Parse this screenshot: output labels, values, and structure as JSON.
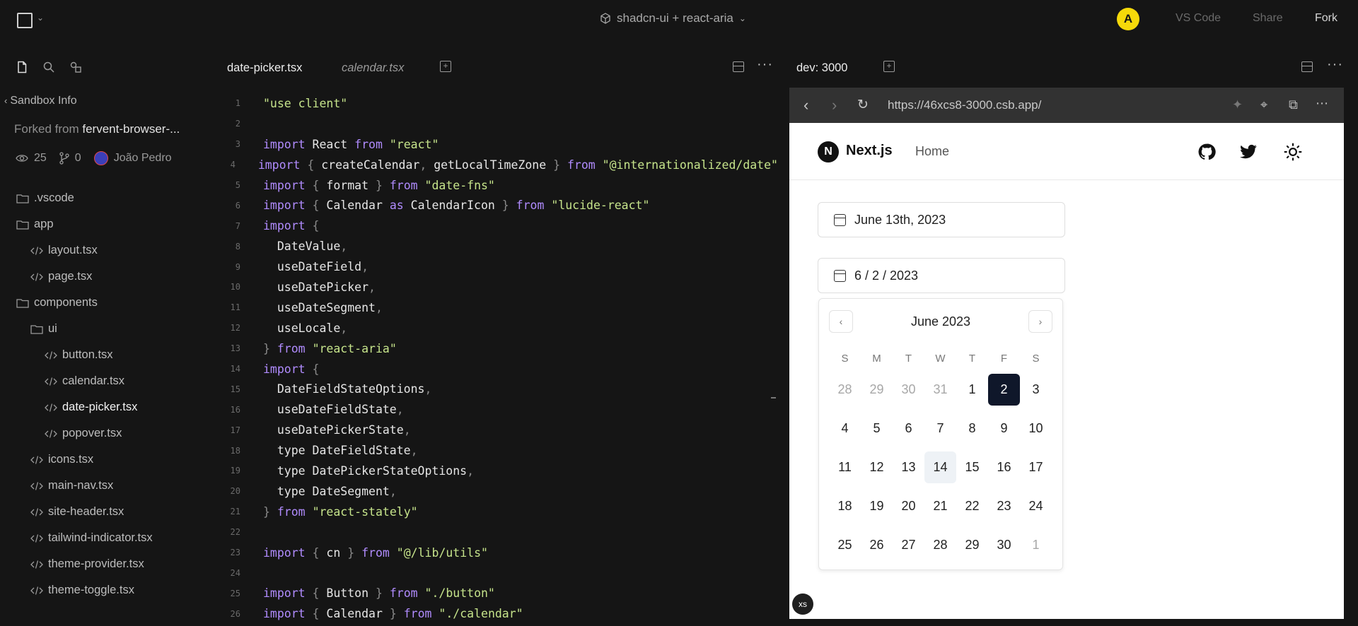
{
  "topbar": {
    "project_name": "shadcn-ui + react-aria",
    "avatar_letter": "A",
    "vscode_label": "VS Code",
    "share_label": "Share",
    "fork_label": "Fork"
  },
  "sidebar": {
    "sandbox_info": "Sandbox Info",
    "forked_prefix": "Forked from ",
    "forked_name": "fervent-browser-...",
    "views": "25",
    "forks": "0",
    "author": "João Pedro",
    "tree": [
      {
        "label": ".vscode",
        "type": "folder",
        "depth": 0
      },
      {
        "label": "app",
        "type": "folder",
        "depth": 0
      },
      {
        "label": "layout.tsx",
        "type": "file",
        "depth": 1
      },
      {
        "label": "page.tsx",
        "type": "file",
        "depth": 1
      },
      {
        "label": "components",
        "type": "folder",
        "depth": 0
      },
      {
        "label": "ui",
        "type": "folder",
        "depth": 1
      },
      {
        "label": "button.tsx",
        "type": "file",
        "depth": 2
      },
      {
        "label": "calendar.tsx",
        "type": "file",
        "depth": 2
      },
      {
        "label": "date-picker.tsx",
        "type": "file",
        "depth": 2,
        "active": true
      },
      {
        "label": "popover.tsx",
        "type": "file",
        "depth": 2
      },
      {
        "label": "icons.tsx",
        "type": "file",
        "depth": 1
      },
      {
        "label": "main-nav.tsx",
        "type": "file",
        "depth": 1
      },
      {
        "label": "site-header.tsx",
        "type": "file",
        "depth": 1
      },
      {
        "label": "tailwind-indicator.tsx",
        "type": "file",
        "depth": 1
      },
      {
        "label": "theme-provider.tsx",
        "type": "file",
        "depth": 1
      },
      {
        "label": "theme-toggle.tsx",
        "type": "file",
        "depth": 1
      }
    ]
  },
  "editor": {
    "tabs": [
      "date-picker.tsx",
      "calendar.tsx"
    ],
    "lines": [
      [
        [
          "s",
          "\"use client\""
        ]
      ],
      [],
      [
        [
          "k",
          "import"
        ],
        [
          "t",
          " React "
        ],
        [
          "k",
          "from"
        ],
        [
          "t",
          " "
        ],
        [
          "s",
          "\"react\""
        ]
      ],
      [
        [
          "k",
          "import"
        ],
        [
          "p",
          " { "
        ],
        [
          "t",
          "createCalendar"
        ],
        [
          "p",
          ", "
        ],
        [
          "t",
          "getLocalTimeZone"
        ],
        [
          "p",
          " } "
        ],
        [
          "k",
          "from"
        ],
        [
          "t",
          " "
        ],
        [
          "s",
          "\"@internationalized/date\""
        ]
      ],
      [
        [
          "k",
          "import"
        ],
        [
          "p",
          " { "
        ],
        [
          "t",
          "format"
        ],
        [
          "p",
          " } "
        ],
        [
          "k",
          "from"
        ],
        [
          "t",
          " "
        ],
        [
          "s",
          "\"date-fns\""
        ]
      ],
      [
        [
          "k",
          "import"
        ],
        [
          "p",
          " { "
        ],
        [
          "t",
          "Calendar "
        ],
        [
          "k",
          "as"
        ],
        [
          "t",
          " CalendarIcon"
        ],
        [
          "p",
          " } "
        ],
        [
          "k",
          "from"
        ],
        [
          "t",
          " "
        ],
        [
          "s",
          "\"lucide-react\""
        ]
      ],
      [
        [
          "k",
          "import"
        ],
        [
          "p",
          " {"
        ]
      ],
      [
        [
          "t",
          "  DateValue"
        ],
        [
          "p",
          ","
        ]
      ],
      [
        [
          "t",
          "  useDateField"
        ],
        [
          "p",
          ","
        ]
      ],
      [
        [
          "t",
          "  useDatePicker"
        ],
        [
          "p",
          ","
        ]
      ],
      [
        [
          "t",
          "  useDateSegment"
        ],
        [
          "p",
          ","
        ]
      ],
      [
        [
          "t",
          "  useLocale"
        ],
        [
          "p",
          ","
        ]
      ],
      [
        [
          "p",
          "} "
        ],
        [
          "k",
          "from"
        ],
        [
          "t",
          " "
        ],
        [
          "s",
          "\"react-aria\""
        ]
      ],
      [
        [
          "k",
          "import"
        ],
        [
          "p",
          " {"
        ]
      ],
      [
        [
          "t",
          "  DateFieldStateOptions"
        ],
        [
          "p",
          ","
        ]
      ],
      [
        [
          "t",
          "  useDateFieldState"
        ],
        [
          "p",
          ","
        ]
      ],
      [
        [
          "t",
          "  useDatePickerState"
        ],
        [
          "p",
          ","
        ]
      ],
      [
        [
          "t",
          "  type DateFieldState"
        ],
        [
          "p",
          ","
        ]
      ],
      [
        [
          "t",
          "  type DatePickerStateOptions"
        ],
        [
          "p",
          ","
        ]
      ],
      [
        [
          "t",
          "  type DateSegment"
        ],
        [
          "p",
          ","
        ]
      ],
      [
        [
          "p",
          "} "
        ],
        [
          "k",
          "from"
        ],
        [
          "t",
          " "
        ],
        [
          "s",
          "\"react-stately\""
        ]
      ],
      [],
      [
        [
          "k",
          "import"
        ],
        [
          "p",
          " { "
        ],
        [
          "t",
          "cn"
        ],
        [
          "p",
          " } "
        ],
        [
          "k",
          "from"
        ],
        [
          "t",
          " "
        ],
        [
          "s",
          "\"@/lib/utils\""
        ]
      ],
      [],
      [
        [
          "k",
          "import"
        ],
        [
          "p",
          " { "
        ],
        [
          "t",
          "Button"
        ],
        [
          "p",
          " } "
        ],
        [
          "k",
          "from"
        ],
        [
          "t",
          " "
        ],
        [
          "s",
          "\"./button\""
        ]
      ],
      [
        [
          "k",
          "import"
        ],
        [
          "p",
          " { "
        ],
        [
          "t",
          "Calendar"
        ],
        [
          "p",
          " } "
        ],
        [
          "k",
          "from"
        ],
        [
          "t",
          " "
        ],
        [
          "s",
          "\"./calendar\""
        ]
      ]
    ]
  },
  "preview": {
    "tab_label": "dev: 3000",
    "url": "https://46xcs8-3000.csb.app/",
    "site": {
      "brand": "Next.js",
      "brand_letter": "N",
      "home_link": "Home"
    },
    "date_picker_1": "June 13th, 2023",
    "date_picker_2": "6 / 2 / 2023",
    "calendar": {
      "title": "June 2023",
      "weekdays": [
        "S",
        "M",
        "T",
        "W",
        "T",
        "F",
        "S"
      ],
      "weeks": [
        [
          [
            "28",
            "o"
          ],
          [
            "29",
            "o"
          ],
          [
            "30",
            "o"
          ],
          [
            "31",
            "o"
          ],
          [
            "1",
            ""
          ],
          [
            "2",
            "sel"
          ],
          [
            "3",
            ""
          ]
        ],
        [
          [
            "4",
            ""
          ],
          [
            "5",
            ""
          ],
          [
            "6",
            ""
          ],
          [
            "7",
            ""
          ],
          [
            "8",
            ""
          ],
          [
            "9",
            ""
          ],
          [
            "10",
            ""
          ]
        ],
        [
          [
            "11",
            ""
          ],
          [
            "12",
            ""
          ],
          [
            "13",
            ""
          ],
          [
            "14",
            "today"
          ],
          [
            "15",
            ""
          ],
          [
            "16",
            ""
          ],
          [
            "17",
            ""
          ]
        ],
        [
          [
            "18",
            ""
          ],
          [
            "19",
            ""
          ],
          [
            "20",
            ""
          ],
          [
            "21",
            ""
          ],
          [
            "22",
            ""
          ],
          [
            "23",
            ""
          ],
          [
            "24",
            ""
          ]
        ],
        [
          [
            "25",
            ""
          ],
          [
            "26",
            ""
          ],
          [
            "27",
            ""
          ],
          [
            "28",
            ""
          ],
          [
            "29",
            ""
          ],
          [
            "30",
            ""
          ],
          [
            "1",
            "o"
          ]
        ]
      ]
    },
    "breakpoint_badge": "xs"
  }
}
